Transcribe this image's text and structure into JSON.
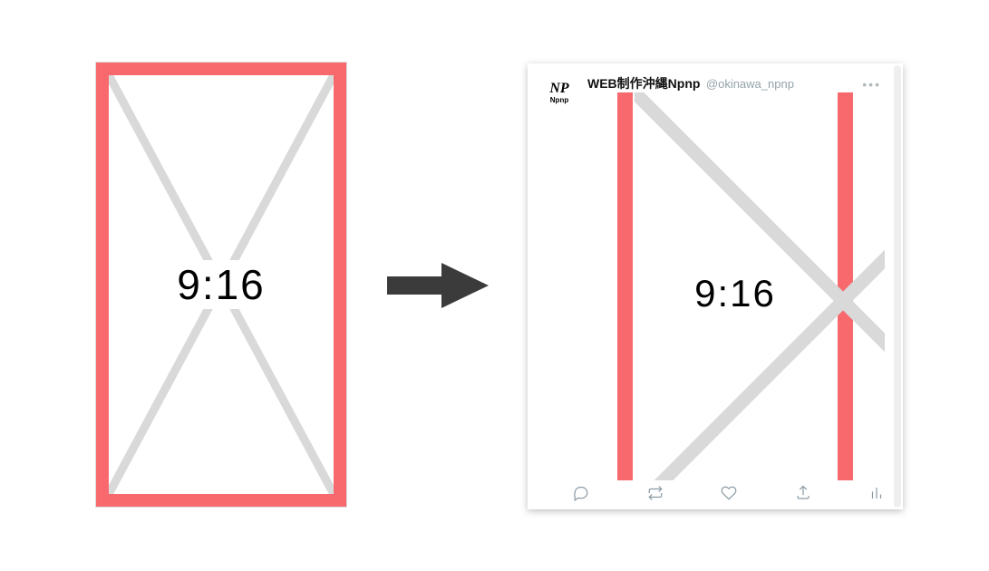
{
  "left_image": {
    "ratio_label": "9:16",
    "border_color": "#f7696d"
  },
  "arrow": {
    "color": "#3b3b3b"
  },
  "tweet": {
    "display_name": "WEB制作沖縄Npnp",
    "handle": "@okinawa_npnp",
    "avatar_logo": "NP",
    "avatar_brand": "Npnp",
    "media_ratio_label": "9:16",
    "red_bar_color": "#f7696d"
  },
  "icons": {
    "more": "more-icon",
    "reply": "reply-icon",
    "retweet": "retweet-icon",
    "like": "like-icon",
    "share": "share-icon",
    "analytics": "analytics-icon"
  }
}
